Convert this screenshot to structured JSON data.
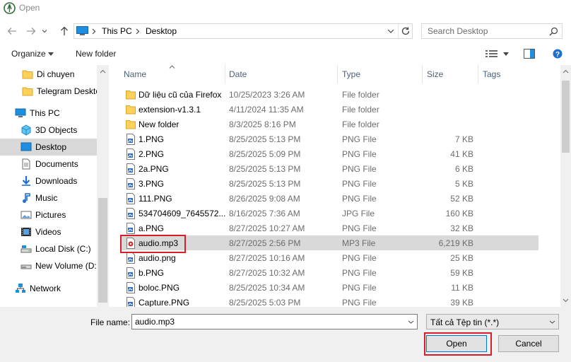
{
  "window": {
    "title": "Open",
    "icon": "app-logo-icon"
  },
  "address": {
    "path": [
      "This PC",
      "Desktop"
    ],
    "search_placeholder": "Search Desktop"
  },
  "toolbar": {
    "organize_label": "Organize",
    "new_folder_label": "New folder"
  },
  "nav": {
    "items": [
      {
        "label": "Di chuyen",
        "icon": "folder-icon",
        "indent": 1
      },
      {
        "label": "Telegram Desktop",
        "icon": "folder-icon",
        "indent": 1
      },
      {
        "label": "This PC",
        "icon": "this-pc-icon",
        "indent": 0
      },
      {
        "label": "3D Objects",
        "icon": "3d-objects-icon",
        "indent": 1
      },
      {
        "label": "Desktop",
        "icon": "desktop-icon",
        "indent": 1,
        "selected": true
      },
      {
        "label": "Documents",
        "icon": "documents-icon",
        "indent": 1
      },
      {
        "label": "Downloads",
        "icon": "downloads-icon",
        "indent": 1
      },
      {
        "label": "Music",
        "icon": "music-icon",
        "indent": 1
      },
      {
        "label": "Pictures",
        "icon": "pictures-icon",
        "indent": 1
      },
      {
        "label": "Videos",
        "icon": "videos-icon",
        "indent": 1
      },
      {
        "label": "Local Disk (C:)",
        "icon": "local-disk-icon",
        "indent": 1
      },
      {
        "label": "New Volume (D:)",
        "icon": "drive-icon",
        "indent": 1
      },
      {
        "label": "Network",
        "icon": "network-icon",
        "indent": 0
      }
    ]
  },
  "list": {
    "headers": {
      "name": "Name",
      "date": "Date",
      "type": "Type",
      "size": "Size",
      "tags": "Tags"
    },
    "rows": [
      {
        "name": "Dữ liệu cũ của Firefox",
        "date": "10/25/2023 3:26 AM",
        "type": "File folder",
        "size": "",
        "icon": "folder-icon"
      },
      {
        "name": "extension-v1.3.1",
        "date": "4/11/2024 11:35 AM",
        "type": "File folder",
        "size": "",
        "icon": "folder-icon"
      },
      {
        "name": "New folder",
        "date": "8/3/2025 8:16 PM",
        "type": "File folder",
        "size": "",
        "icon": "folder-icon"
      },
      {
        "name": "1.PNG",
        "date": "8/25/2025 5:13 PM",
        "type": "PNG File",
        "size": "7 KB",
        "icon": "image-file-icon"
      },
      {
        "name": "2.PNG",
        "date": "8/25/2025 5:09 PM",
        "type": "PNG File",
        "size": "41 KB",
        "icon": "image-file-icon"
      },
      {
        "name": "2a.PNG",
        "date": "8/25/2025 5:13 PM",
        "type": "PNG File",
        "size": "6 KB",
        "icon": "image-file-icon"
      },
      {
        "name": "3.PNG",
        "date": "8/25/2025 5:13 PM",
        "type": "PNG File",
        "size": "5 KB",
        "icon": "image-file-icon"
      },
      {
        "name": "111.PNG",
        "date": "8/26/2025 9:08 AM",
        "type": "PNG File",
        "size": "52 KB",
        "icon": "image-file-icon"
      },
      {
        "name": "534704609_7645572...",
        "date": "8/16/2025 7:36 AM",
        "type": "JPG File",
        "size": "160 KB",
        "icon": "image-file-icon"
      },
      {
        "name": "a.PNG",
        "date": "8/27/2025 10:27 AM",
        "type": "PNG File",
        "size": "32 KB",
        "icon": "image-file-icon"
      },
      {
        "name": "audio.mp3",
        "date": "8/27/2025 2:56 PM",
        "type": "MP3 File",
        "size": "6,219 KB",
        "icon": "audio-file-icon",
        "selected": true
      },
      {
        "name": "audio.png",
        "date": "8/27/2025 10:16 AM",
        "type": "PNG File",
        "size": "25 KB",
        "icon": "image-file-icon"
      },
      {
        "name": "b.PNG",
        "date": "8/27/2025 10:32 AM",
        "type": "PNG File",
        "size": "59 KB",
        "icon": "image-file-icon"
      },
      {
        "name": "boloc.PNG",
        "date": "8/25/2025 10:34 AM",
        "type": "PNG File",
        "size": "11 KB",
        "icon": "image-file-icon"
      },
      {
        "name": "Capture.PNG",
        "date": "8/25/2025 5:03 PM",
        "type": "PNG File",
        "size": "39 KB",
        "icon": "image-file-icon"
      }
    ]
  },
  "bottom": {
    "file_name_label": "File name:",
    "file_name_value": "audio.mp3",
    "filter_value": "Tất cả Tệp tin (*.*)",
    "open_label": "Open",
    "cancel_label": "Cancel"
  },
  "colors": {
    "highlight": "#d91e2a",
    "selection": "#d9d9d9",
    "header_text": "#4c607a"
  }
}
